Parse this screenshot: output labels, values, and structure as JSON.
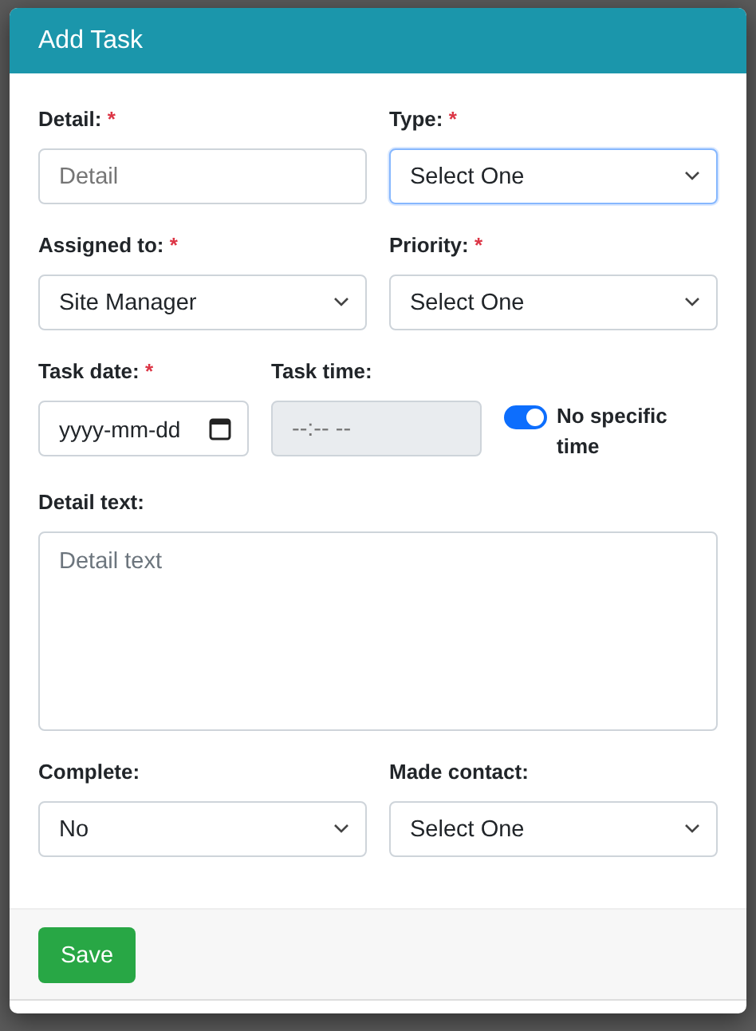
{
  "modal": {
    "title": "Add Task"
  },
  "rows": [
    {
      "fields": [
        {
          "kind": "text",
          "label": "Detail:",
          "required_mark": "*",
          "placeholder": "Detail",
          "focused": false,
          "disabled": false
        },
        {
          "kind": "select",
          "label": "Type:",
          "required_mark": "*",
          "value": "Select One",
          "focused": true,
          "disabled": false
        }
      ]
    },
    {
      "fields": [
        {
          "kind": "select",
          "label": "Assigned to:",
          "required_mark": "*",
          "value": "Site Manager",
          "focused": false,
          "disabled": false
        },
        {
          "kind": "select",
          "label": "Priority:",
          "required_mark": "*",
          "value": "Select One",
          "focused": false,
          "disabled": false
        }
      ]
    },
    {
      "fields": [
        {
          "kind": "date",
          "label": "Task date:",
          "required_mark": "*",
          "placeholder": "yyyy-mm-dd",
          "focused": false,
          "disabled": false
        },
        {
          "kind": "time",
          "label": "Task time:",
          "placeholder": "--:-- --",
          "focused": false,
          "disabled": true
        },
        {
          "kind": "toggle",
          "label": "No specific time",
          "on": true
        }
      ]
    },
    {
      "fields": [
        {
          "kind": "textarea",
          "label": "Detail text:",
          "placeholder": "Detail text",
          "focused": false,
          "disabled": false
        }
      ]
    },
    {
      "fields": [
        {
          "kind": "select",
          "label": "Complete:",
          "value": "No",
          "focused": false,
          "disabled": false
        },
        {
          "kind": "select",
          "label": "Made contact:",
          "value": "Select One",
          "focused": false,
          "disabled": false
        }
      ]
    }
  ],
  "footer": {
    "buttons": [
      {
        "label": "Save"
      }
    ]
  }
}
